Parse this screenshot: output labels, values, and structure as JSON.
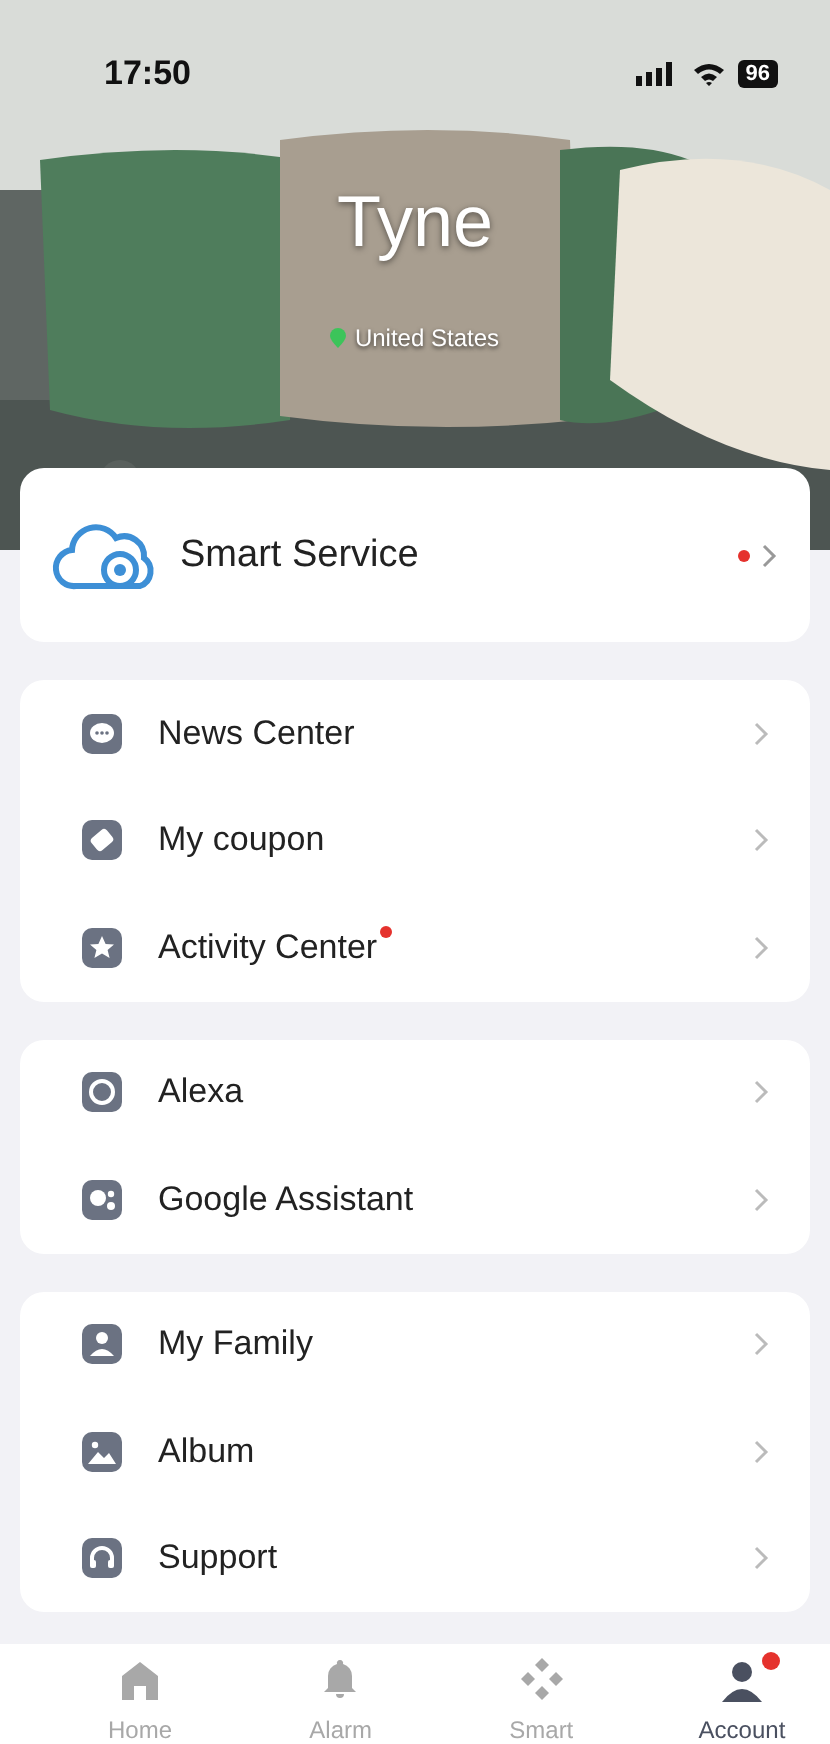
{
  "status_bar": {
    "time": "17:50",
    "battery": "96"
  },
  "profile": {
    "name": "Tyne",
    "region": "United States"
  },
  "service": {
    "label": "Smart Service",
    "badge": true
  },
  "groups": [
    {
      "items": [
        {
          "label": "News Center",
          "badge": false
        },
        {
          "label": "My coupon",
          "badge": false
        },
        {
          "label": "Activity Center",
          "badge": true
        }
      ]
    },
    {
      "items": [
        {
          "label": "Alexa",
          "badge": false
        },
        {
          "label": "Google Assistant",
          "badge": false
        }
      ]
    },
    {
      "items": [
        {
          "label": "My Family",
          "badge": false
        },
        {
          "label": "Album",
          "badge": false
        },
        {
          "label": "Support",
          "badge": false
        }
      ]
    }
  ],
  "tabs": [
    {
      "label": "Home",
      "selected": false,
      "badge": false
    },
    {
      "label": "Alarm",
      "selected": false,
      "badge": false
    },
    {
      "label": "Smart",
      "selected": false,
      "badge": false
    },
    {
      "label": "Account",
      "selected": true,
      "badge": true
    }
  ]
}
